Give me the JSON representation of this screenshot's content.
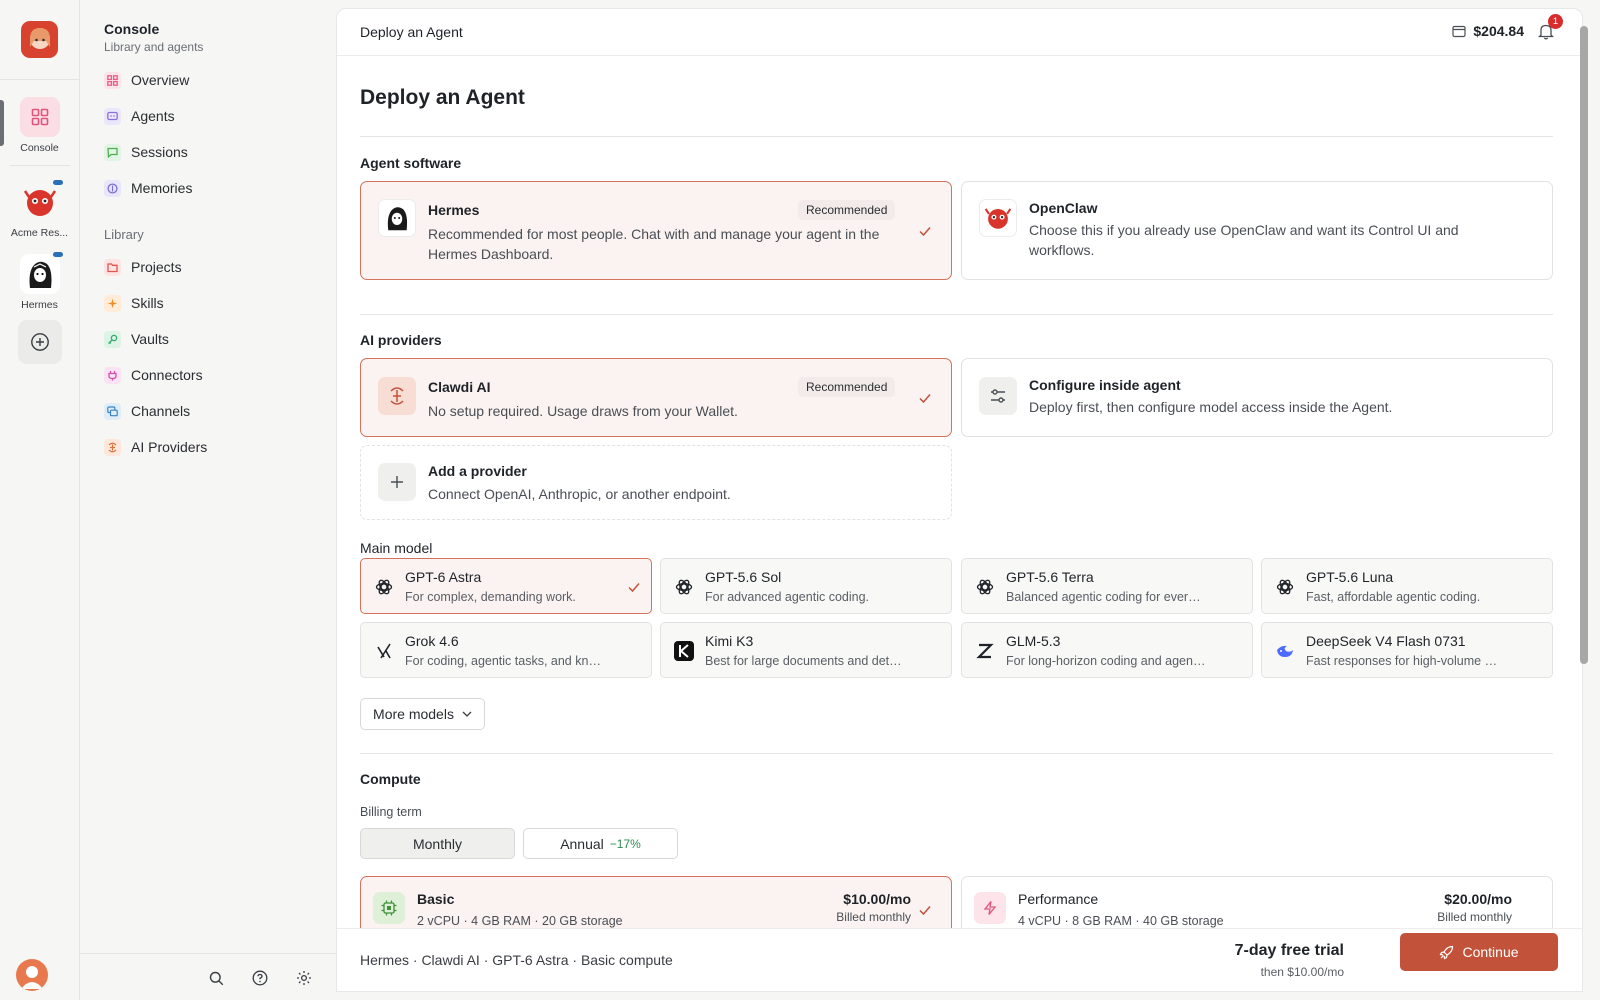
{
  "rail": {
    "items": [
      {
        "label": "Console"
      },
      {
        "label": "Acme Res..."
      },
      {
        "label": "Hermes"
      }
    ]
  },
  "sidebar": {
    "title": "Console",
    "subtitle": "Library and agents",
    "nav": [
      {
        "label": "Overview",
        "icon": "overview-icon",
        "color": "#e85d88"
      },
      {
        "label": "Agents",
        "icon": "agents-icon",
        "color": "#8a6fd8"
      },
      {
        "label": "Sessions",
        "icon": "sessions-icon",
        "color": "#4caf50"
      },
      {
        "label": "Memories",
        "icon": "memories-icon",
        "color": "#7a6ed8"
      }
    ],
    "library_label": "Library",
    "library": [
      {
        "label": "Projects",
        "icon": "projects-icon",
        "color": "#e0554f"
      },
      {
        "label": "Skills",
        "icon": "skills-icon",
        "color": "#f08a24"
      },
      {
        "label": "Vaults",
        "icon": "vaults-icon",
        "color": "#2fa86b"
      },
      {
        "label": "Connectors",
        "icon": "connectors-icon",
        "color": "#d24fb0"
      },
      {
        "label": "Channels",
        "icon": "channels-icon",
        "color": "#3b82c4"
      },
      {
        "label": "AI Providers",
        "icon": "ai-providers-icon",
        "color": "#e0703a"
      }
    ]
  },
  "topbar": {
    "breadcrumb": "Deploy an Agent",
    "wallet": "$204.84",
    "notifications": "1"
  },
  "page": {
    "title": "Deploy an Agent",
    "agent_software": {
      "title": "Agent software",
      "options": [
        {
          "name": "Hermes",
          "badge": "Recommended",
          "desc": "Recommended for most people. Chat with and manage your agent in the Hermes Dashboard.",
          "selected": true
        },
        {
          "name": "OpenClaw",
          "desc": "Choose this if you already use OpenClaw and want its Control UI and workflows.",
          "selected": false
        }
      ]
    },
    "ai_providers": {
      "title": "AI providers",
      "options": [
        {
          "name": "Clawdi AI",
          "badge": "Recommended",
          "desc": "No setup required. Usage draws from your Wallet.",
          "selected": true
        },
        {
          "name": "Configure inside agent",
          "desc": "Deploy first, then configure model access inside the Agent.",
          "selected": false
        },
        {
          "name": "Add a provider",
          "desc": "Connect OpenAI, Anthropic, or another endpoint."
        }
      ]
    },
    "main_model": {
      "title": "Main model",
      "models": [
        {
          "name": "GPT-6 Astra",
          "desc": "For complex, demanding work.",
          "icon": "openai-icon",
          "selected": true
        },
        {
          "name": "GPT-5.6 Sol",
          "desc": "For advanced agentic coding.",
          "icon": "openai-icon"
        },
        {
          "name": "GPT-5.6 Terra",
          "desc": "Balanced agentic coding for everyd...",
          "icon": "openai-icon"
        },
        {
          "name": "GPT-5.6 Luna",
          "desc": "Fast, affordable agentic coding.",
          "icon": "openai-icon"
        },
        {
          "name": "Grok 4.6",
          "desc": "For coding, agentic tasks, and knowl...",
          "icon": "grok-icon"
        },
        {
          "name": "Kimi K3",
          "desc": "Best for large documents and detail...",
          "icon": "kimi-icon"
        },
        {
          "name": "GLM-5.3",
          "desc": "For long-horizon coding and agentic...",
          "icon": "glm-icon"
        },
        {
          "name": "DeepSeek V4 Flash 0731",
          "desc": "Fast responses for high-volume work.",
          "icon": "deepseek-icon"
        }
      ],
      "more_label": "More models"
    },
    "compute": {
      "title": "Compute",
      "billing_label": "Billing term",
      "terms": [
        {
          "label": "Monthly",
          "active": true
        },
        {
          "label": "Annual",
          "discount": "−17%",
          "active": false
        }
      ],
      "plans": [
        {
          "name": "Basic",
          "specs": "2 vCPU · 4 GB RAM · 20 GB storage",
          "price": "$10.00/mo",
          "billing": "Billed monthly",
          "selected": true
        },
        {
          "name": "Performance",
          "specs": "4 vCPU · 8 GB RAM · 40 GB storage",
          "price": "$20.00/mo",
          "billing": "Billed monthly",
          "selected": false
        }
      ]
    }
  },
  "footer": {
    "summary": "Hermes · Clawdi AI · GPT-6 Astra · Basic compute",
    "trial_title": "7-day free trial",
    "trial_sub": "then $10.00/mo",
    "continue_label": "Continue"
  },
  "colors": {
    "accent": "#c2533a",
    "selected_border": "#d4725e",
    "selected_bg": "#fbf3f1"
  }
}
